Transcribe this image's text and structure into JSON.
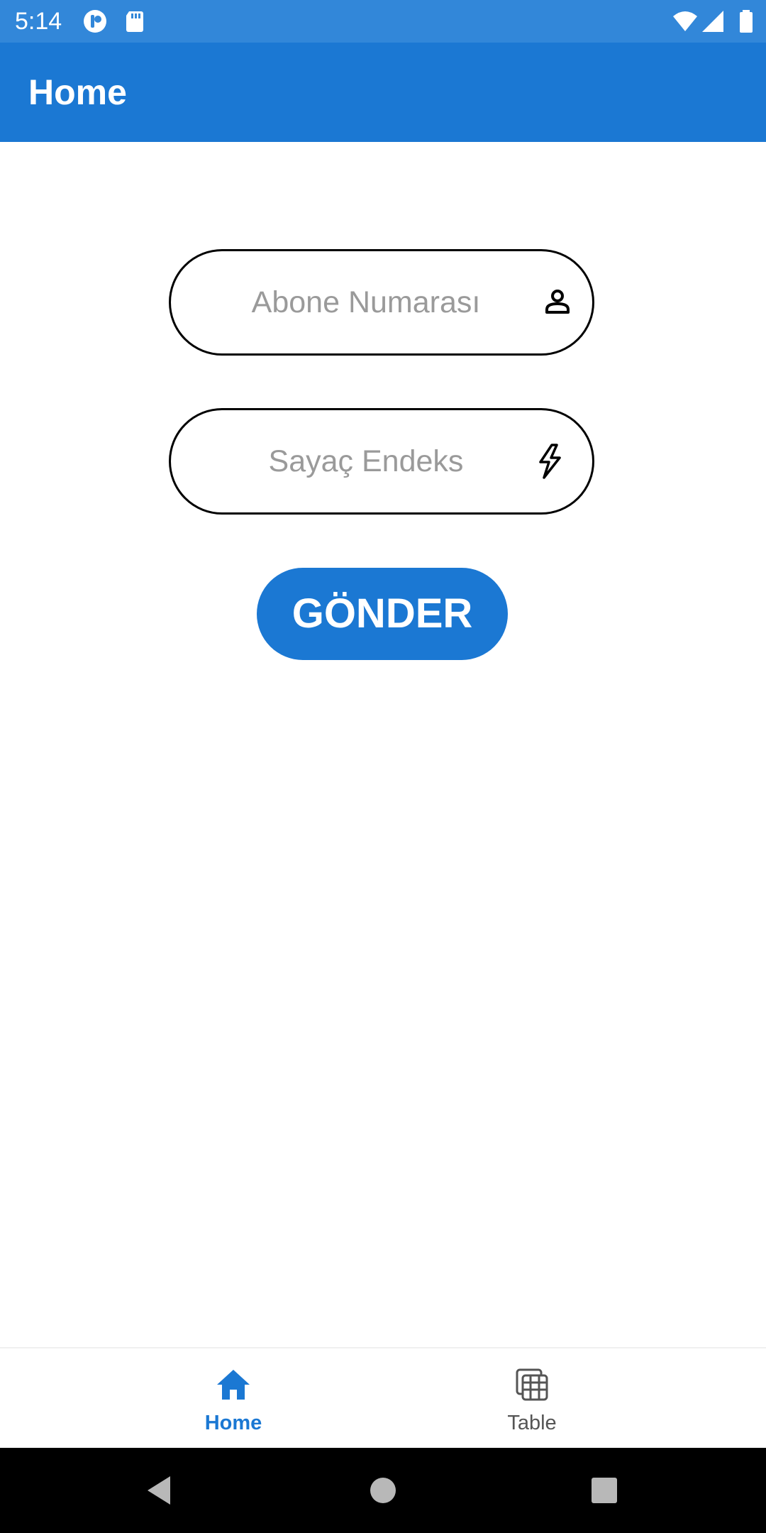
{
  "status_bar": {
    "time": "5:14",
    "icons": [
      "app-notification-icon",
      "sd-card-icon",
      "wifi-icon",
      "cellular-signal-icon",
      "battery-icon"
    ]
  },
  "app_bar": {
    "title": "Home"
  },
  "form": {
    "subscriber_number": {
      "placeholder": "Abone Numarası",
      "value": "",
      "icon": "person-icon"
    },
    "meter_index": {
      "placeholder": "Sayaç Endeks",
      "value": "",
      "icon": "lightning-bolt-icon"
    },
    "submit_label": "GÖNDER"
  },
  "bottom_nav": {
    "items": [
      {
        "label": "Home",
        "icon": "home-icon",
        "active": true
      },
      {
        "label": "Table",
        "icon": "table-icon",
        "active": false
      }
    ]
  },
  "system_nav": {
    "buttons": [
      "back-icon",
      "home-circle-icon",
      "recents-icon"
    ]
  },
  "colors": {
    "status_bar": "#3287d9",
    "primary": "#1b78d3",
    "placeholder": "#9a9a9a",
    "inactive_nav": "#555555"
  }
}
